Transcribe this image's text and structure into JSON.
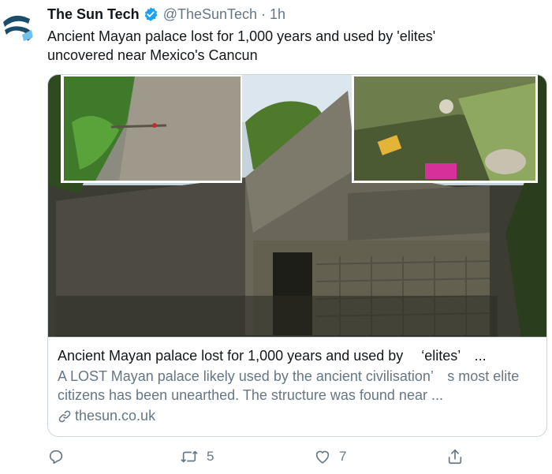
{
  "tweet": {
    "display_name": "The Sun Tech",
    "handle": "@TheSunTech",
    "separator": "·",
    "time": "1h",
    "text_line1": "Ancient Mayan palace lost for 1,000 years and used by 'elites'",
    "text_line2": "uncovered near Mexico's Cancun"
  },
  "card": {
    "title": "Ancient Mayan palace lost for 1,000 years and used by 　‘elites’　...",
    "description": "A LOST Mayan palace likely used by the ancient civilisation’　s most elite citizens has been unearthed. The structure was found near ...",
    "link": "thesun.co.uk"
  },
  "actions": {
    "reply_count": "",
    "retweet_count": "5",
    "like_count": "7"
  },
  "colors": {
    "text": "#14171a",
    "secondary": "#657786",
    "border": "#ccd6dd",
    "verified": "#1da1f2",
    "brand": "#1b4d6b"
  },
  "icons": [
    "verified-badge-icon",
    "link-icon",
    "reply-icon",
    "retweet-icon",
    "like-icon",
    "share-icon"
  ]
}
